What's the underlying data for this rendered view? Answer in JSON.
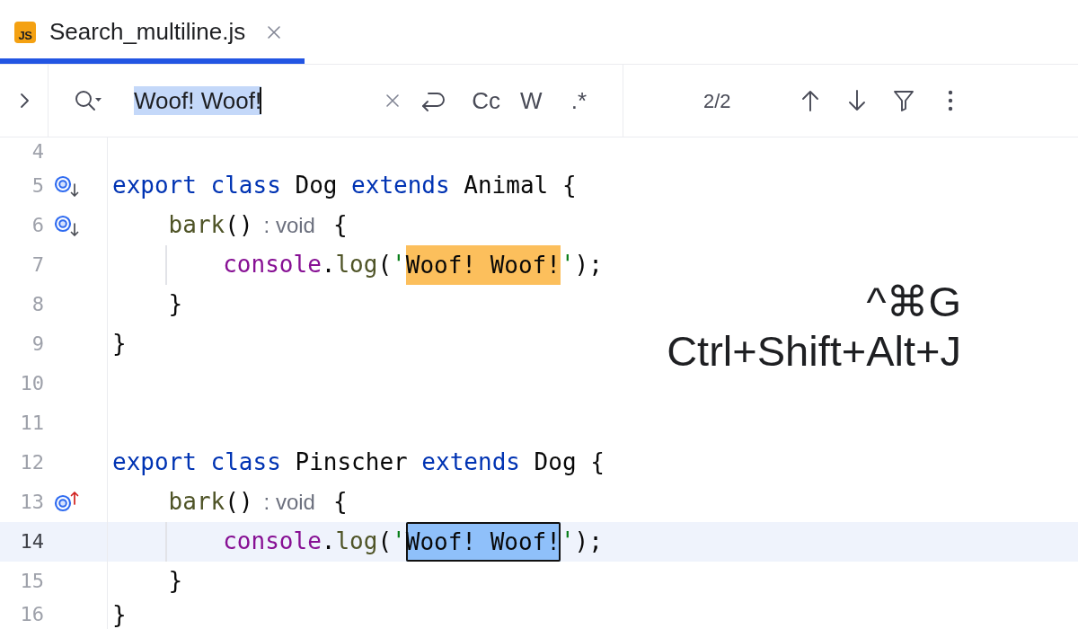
{
  "tabs": [
    {
      "label": "Search_multiline.js",
      "icon_text": "JS",
      "selected": true
    }
  ],
  "find_bar": {
    "query": "Woof! Woof!",
    "query_selected": true,
    "options": [
      "Cc",
      "W",
      ".*"
    ],
    "match_count": "2/2"
  },
  "editor": {
    "lines": [
      {
        "number": "4",
        "current": false
      },
      {
        "number": "5",
        "current": false,
        "gutter_icon": {
          "kind": "implemented"
        },
        "tokens": [
          {
            "kind": "keyword",
            "text": "export"
          },
          {
            "kind": "keyword",
            "text": "class",
            "space_before": true
          },
          {
            "kind": "plain",
            "text": "Dog",
            "space_before": true
          },
          {
            "kind": "keyword",
            "text": "extends",
            "space_before": true
          },
          {
            "kind": "plain",
            "text": "Animal",
            "space_before": true
          },
          {
            "kind": "plain",
            "text": "{",
            "space_before": true
          }
        ],
        "children": [
          {
            "number": "6",
            "current": false,
            "gutter_icon": {
              "kind": "implemented"
            },
            "tokens": [
              {
                "kind": "method",
                "text": "bark"
              },
              {
                "kind": "plain",
                "text": "()"
              },
              {
                "kind": "hint",
                "text": ": void"
              },
              {
                "kind": "plain",
                "text": "{"
              }
            ],
            "children": [
              {
                "number": "7",
                "current": false,
                "tokens": [
                  {
                    "kind": "object",
                    "text": "console"
                  },
                  {
                    "kind": "plain",
                    "text": "."
                  },
                  {
                    "kind": "method",
                    "text": "log"
                  },
                  {
                    "kind": "plain",
                    "text": "("
                  },
                  {
                    "kind": "string",
                    "text": "'"
                  },
                  {
                    "kind": "match",
                    "text": "Woof! Woof!",
                    "selected": false
                  },
                  {
                    "kind": "string",
                    "text": "'"
                  },
                  {
                    "kind": "plain",
                    "text": ");"
                  }
                ]
              }
            ]
          },
          {
            "number": "8",
            "current": false,
            "tokens": [
              {
                "kind": "plain",
                "text": "}"
              }
            ]
          }
        ]
      },
      {
        "number": "9",
        "current": false,
        "tokens": [
          {
            "kind": "plain",
            "text": "}"
          }
        ]
      },
      {
        "number": "10",
        "current": false
      },
      {
        "number": "11",
        "current": false
      },
      {
        "number": "12",
        "current": false,
        "tokens": [
          {
            "kind": "keyword",
            "text": "export"
          },
          {
            "kind": "keyword",
            "text": "class",
            "space_before": true
          },
          {
            "kind": "plain",
            "text": "Pinscher",
            "space_before": true
          },
          {
            "kind": "keyword",
            "text": "extends",
            "space_before": true
          },
          {
            "kind": "plain",
            "text": "Dog",
            "space_before": true
          },
          {
            "kind": "plain",
            "text": "{",
            "space_before": true
          }
        ],
        "children": [
          {
            "number": "13",
            "current": false,
            "gutter_icon": {
              "kind": "overriding"
            },
            "tokens": [
              {
                "kind": "method",
                "text": "bark"
              },
              {
                "kind": "plain",
                "text": "()"
              },
              {
                "kind": "hint",
                "text": ": void"
              },
              {
                "kind": "plain",
                "text": "{"
              }
            ],
            "children": [
              {
                "number": "14",
                "current": true,
                "tokens": [
                  {
                    "kind": "object",
                    "text": "console"
                  },
                  {
                    "kind": "plain",
                    "text": "."
                  },
                  {
                    "kind": "method",
                    "text": "log"
                  },
                  {
                    "kind": "plain",
                    "text": "("
                  },
                  {
                    "kind": "string",
                    "text": "'"
                  },
                  {
                    "kind": "match",
                    "text": "Woof! Woof!",
                    "selected": true
                  },
                  {
                    "kind": "string",
                    "text": "'"
                  },
                  {
                    "kind": "plain",
                    "text": ");"
                  }
                ]
              }
            ]
          },
          {
            "number": "15",
            "current": false,
            "tokens": [
              {
                "kind": "plain",
                "text": "}"
              }
            ]
          }
        ]
      },
      {
        "number": "16",
        "current": false,
        "tokens": [
          {
            "kind": "plain",
            "text": "}"
          }
        ]
      }
    ]
  },
  "shortcut_overlay": {
    "lines": [
      "^⌘G",
      "Ctrl+Shift+Alt+J"
    ]
  }
}
